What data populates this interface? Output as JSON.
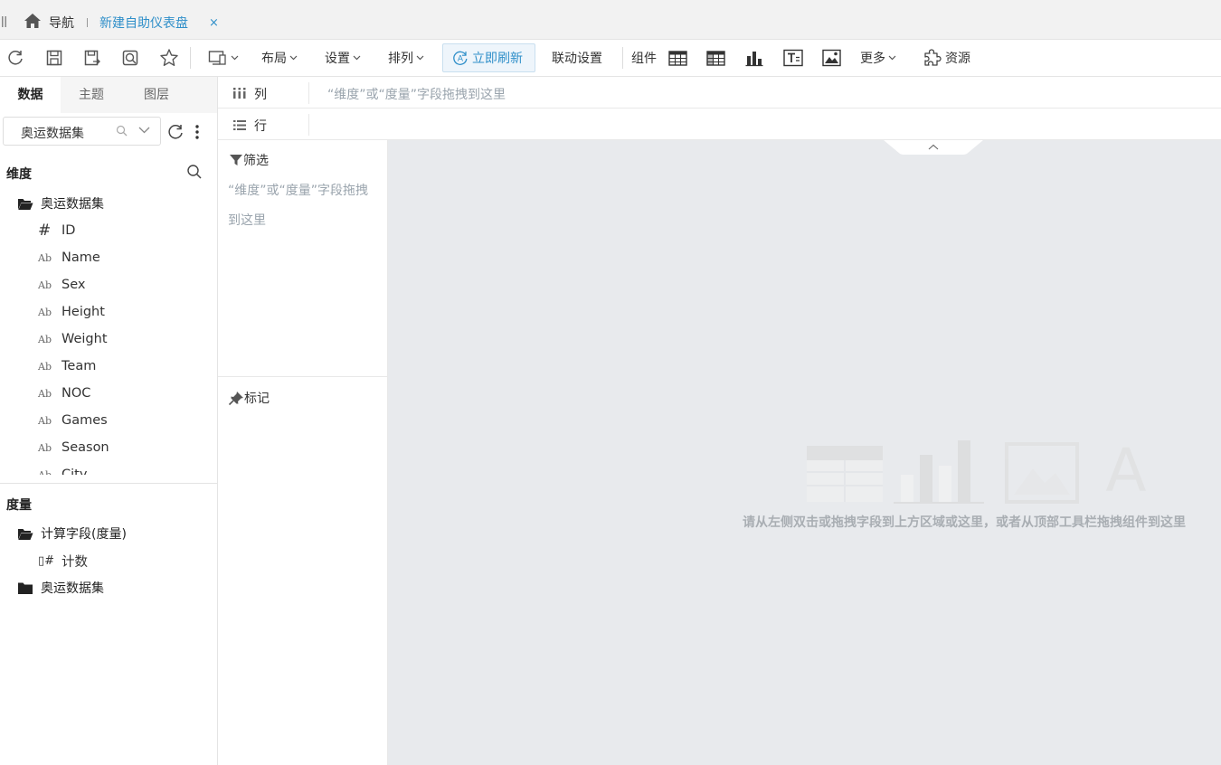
{
  "tabbar": {
    "nav_label": "导航",
    "tab_title": "新建自助仪表盘",
    "close_glyph": "×"
  },
  "toolbar": {
    "layout_label": "布局",
    "settings_label": "设置",
    "arrange_label": "排列",
    "refresh_now_label": "立即刷新",
    "link_settings_label": "联动设置",
    "components_label": "组件",
    "more_label": "更多",
    "resources_label": "资源"
  },
  "left_panel": {
    "tabs": [
      "数据",
      "主题",
      "图层"
    ],
    "dataset_select": "奥运数据集",
    "dimensions_title": "维度",
    "dimension_folder": "奥运数据集",
    "dimension_fields": [
      {
        "icon": "#",
        "name": "ID"
      },
      {
        "icon": "Ab",
        "name": "Name"
      },
      {
        "icon": "Ab",
        "name": "Sex"
      },
      {
        "icon": "Ab",
        "name": "Height"
      },
      {
        "icon": "Ab",
        "name": "Weight"
      },
      {
        "icon": "Ab",
        "name": "Team"
      },
      {
        "icon": "Ab",
        "name": "NOC"
      },
      {
        "icon": "Ab",
        "name": "Games"
      },
      {
        "icon": "Ab",
        "name": "Season"
      },
      {
        "icon": "Ab",
        "name": "City"
      }
    ],
    "measures_title": "度量",
    "measure_folder_calc": "计算字段(度量)",
    "measure_count_icon": "▯#",
    "measure_count": "计数",
    "measure_folder_dataset": "奥运数据集"
  },
  "shelves": {
    "columns_label": "列",
    "rows_label": "行",
    "columns_hint": "“维度”或“度量”字段拖拽到这里"
  },
  "filter_panel": {
    "filter_label": "筛选",
    "filter_hint": "“维度”或“度量”字段拖拽到这里",
    "marks_label": "标记"
  },
  "canvas": {
    "empty_hint": "请从左侧双击或拖拽字段到上方区域或这里，或者从顶部工具栏拖拽组件到这里"
  },
  "colors": {
    "accent": "#2f8fc9",
    "canvas_bg": "#e8eaed",
    "hint_text": "#9aa4ad"
  }
}
